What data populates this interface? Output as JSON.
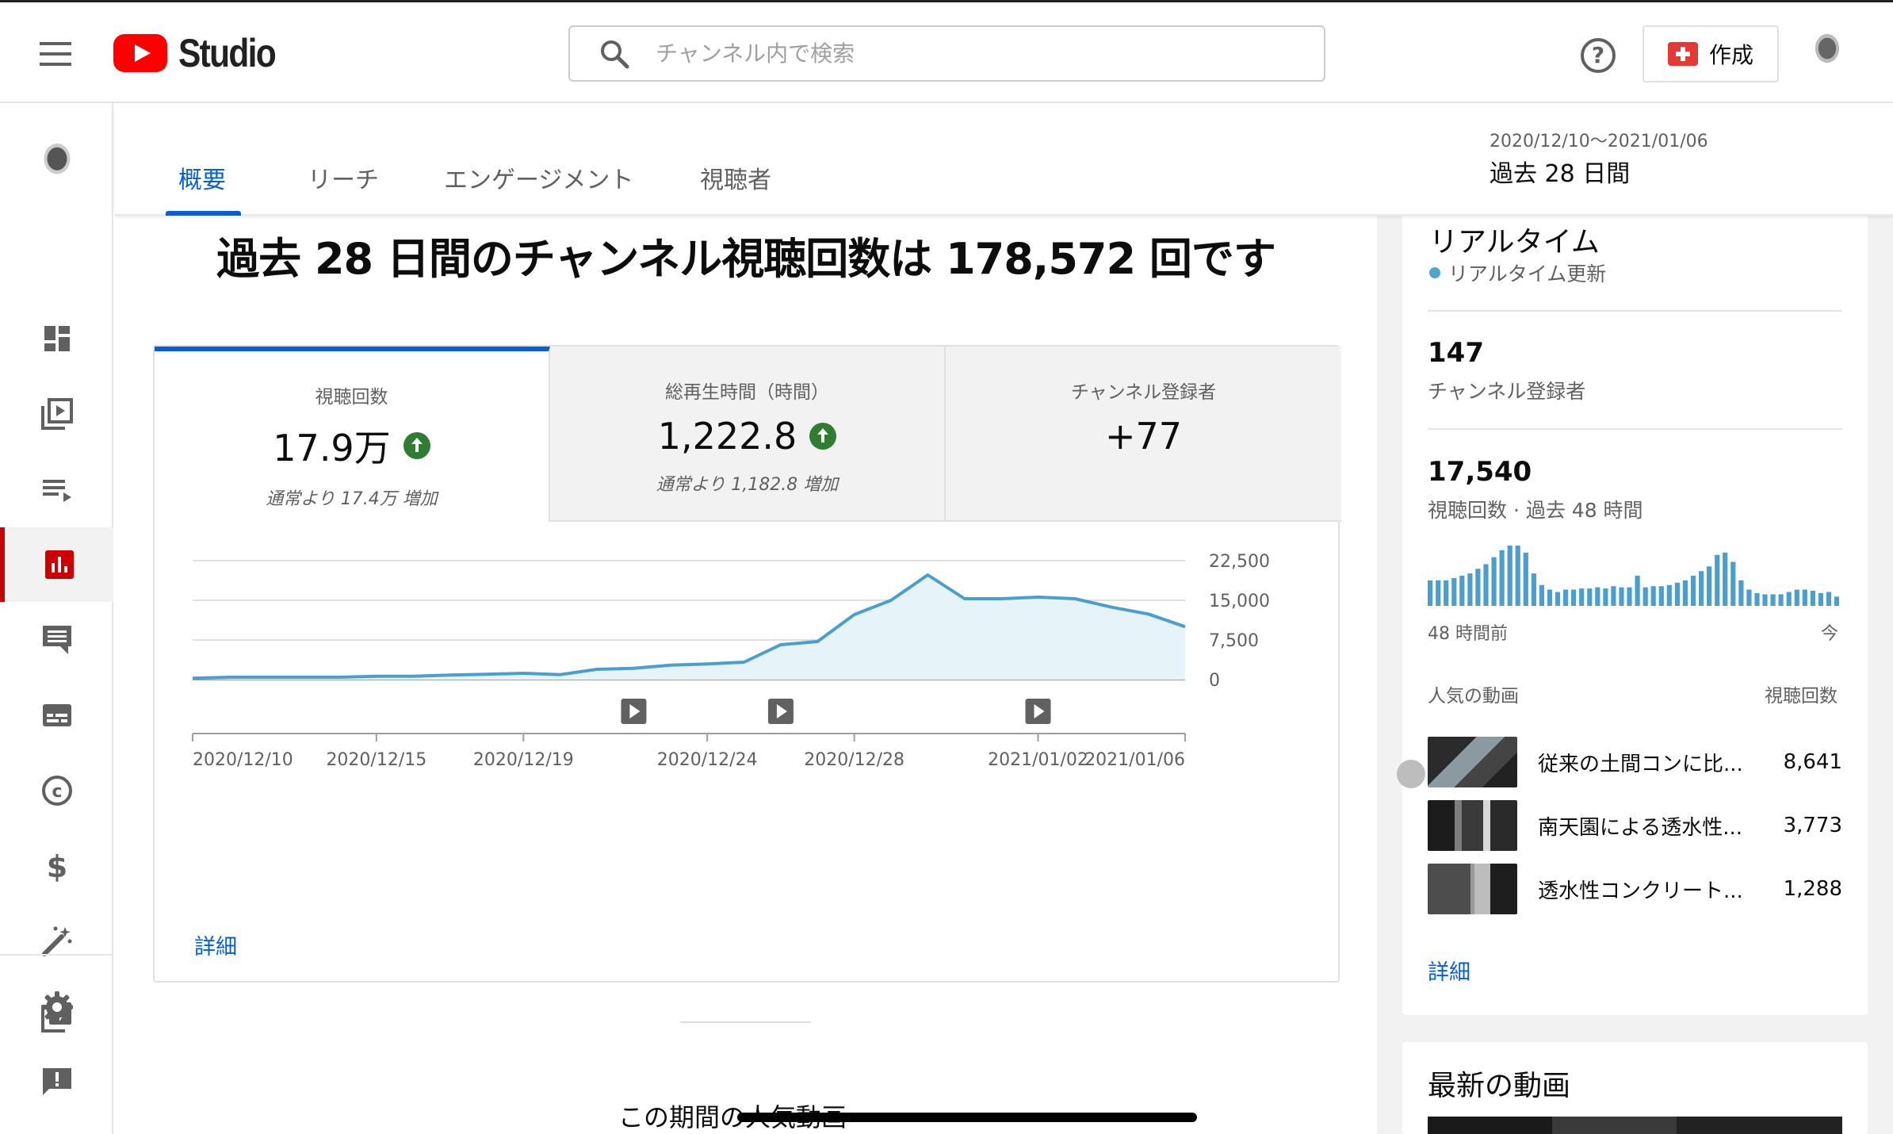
{
  "header": {
    "logo_text": "Studio",
    "search_placeholder": "チャンネル内で検索",
    "help_label": "?",
    "create_label": "作成"
  },
  "sidebar": {
    "items": [
      {
        "name": "dashboard-icon",
        "active": false
      },
      {
        "name": "content-icon",
        "active": false
      },
      {
        "name": "playlists-icon",
        "active": false
      },
      {
        "name": "analytics-icon",
        "active": true
      },
      {
        "name": "comments-icon",
        "active": false
      },
      {
        "name": "subtitles-icon",
        "active": false
      },
      {
        "name": "copyright-icon",
        "active": false
      },
      {
        "name": "monetization-icon",
        "active": false
      },
      {
        "name": "customization-icon",
        "active": false
      },
      {
        "name": "audio-library-icon",
        "active": false
      },
      {
        "name": "settings-icon",
        "active": false
      },
      {
        "name": "feedback-icon",
        "active": false
      }
    ]
  },
  "tabs": [
    "概要",
    "リーチ",
    "エンゲージメント",
    "視聴者"
  ],
  "date_range": {
    "range": "2020/12/10〜2021/01/06",
    "label": "過去 28 日間"
  },
  "main": {
    "headline": "過去 28 日間のチャンネル視聴回数は 178,572 回です",
    "metrics": [
      {
        "title": "視聴回数",
        "value": "17.9万",
        "up": true,
        "sub": "通常より 17.4万 増加"
      },
      {
        "title": "総再生時間（時間）",
        "value": "1,222.8",
        "up": true,
        "sub": "通常より 1,182.8 増加"
      },
      {
        "title": "チャンネル登録者",
        "value": "+77",
        "up": false,
        "sub": ""
      }
    ],
    "detail_label": "詳細",
    "popular_title": "この期間の人気動画"
  },
  "chart_data": {
    "type": "area",
    "x": [
      "2020/12/10",
      "2020/12/11",
      "2020/12/12",
      "2020/12/13",
      "2020/12/14",
      "2020/12/15",
      "2020/12/16",
      "2020/12/17",
      "2020/12/18",
      "2020/12/19",
      "2020/12/20",
      "2020/12/21",
      "2020/12/22",
      "2020/12/23",
      "2020/12/24",
      "2020/12/25",
      "2020/12/26",
      "2020/12/27",
      "2020/12/28",
      "2020/12/29",
      "2020/12/30",
      "2020/12/31",
      "2021/01/01",
      "2021/01/02",
      "2021/01/03",
      "2021/01/04",
      "2021/01/05",
      "2021/01/06"
    ],
    "values": [
      250,
      450,
      450,
      450,
      450,
      650,
      650,
      850,
      1000,
      1200,
      950,
      1950,
      2150,
      2750,
      2950,
      3300,
      6600,
      7200,
      12300,
      15000,
      19800,
      15300,
      15300,
      15600,
      15300,
      13700,
      12400,
      10000
    ],
    "xticks": [
      "2020/12/10",
      "2020/12/15",
      "2020/12/19",
      "2020/12/24",
      "2020/12/28",
      "2021/01/02",
      "2021/01/06"
    ],
    "yticks": [
      "22,500",
      "15,000",
      "7,500",
      "0"
    ],
    "ylim": [
      0,
      22500
    ],
    "markers": [
      "2020/12/22",
      "2020/12/26",
      "2021/01/02"
    ],
    "line_color": "#4a9fce",
    "fill_color": "#e6f4fa"
  },
  "realtime": {
    "title": "リアルタイム",
    "status": "リアルタイム更新",
    "subscribers": "147",
    "subscribers_label": "チャンネル登録者",
    "views": "17,540",
    "views_label": "視聴回数 · 過去 48 時間",
    "hourly": [
      2.2,
      2.2,
      2.2,
      2.4,
      2.6,
      2.8,
      3.2,
      3.6,
      4.2,
      4.8,
      5.2,
      5.2,
      4.6,
      2.8,
      1.8,
      1.4,
      1.2,
      1.4,
      1.4,
      1.5,
      1.5,
      1.6,
      1.5,
      1.7,
      1.6,
      1.6,
      2.6,
      1.6,
      1.7,
      1.7,
      1.8,
      2.0,
      2.2,
      2.6,
      3.0,
      3.4,
      4.4,
      4.6,
      3.8,
      2.2,
      1.4,
      1.1,
      1.0,
      1.0,
      1.0,
      1.2,
      1.4,
      1.4,
      1.3,
      1.1,
      1.2,
      0.8
    ],
    "bars_left": "48 時間前",
    "bars_right": "今",
    "popular_head": "人気の動画",
    "views_head": "視聴回数",
    "videos": [
      {
        "title": "従来の土間コンに比...",
        "views": "8,641"
      },
      {
        "title": "南天園による透水性...",
        "views": "3,773"
      },
      {
        "title": "透水性コンクリート...",
        "views": "1,288"
      }
    ],
    "detail_label": "詳細"
  },
  "latest": {
    "title": "最新の動画"
  },
  "colors": {
    "accent": "#065fd4",
    "brand_red": "#ff0000",
    "positive": "#2e7d32",
    "chart_line": "#4a9fce"
  }
}
